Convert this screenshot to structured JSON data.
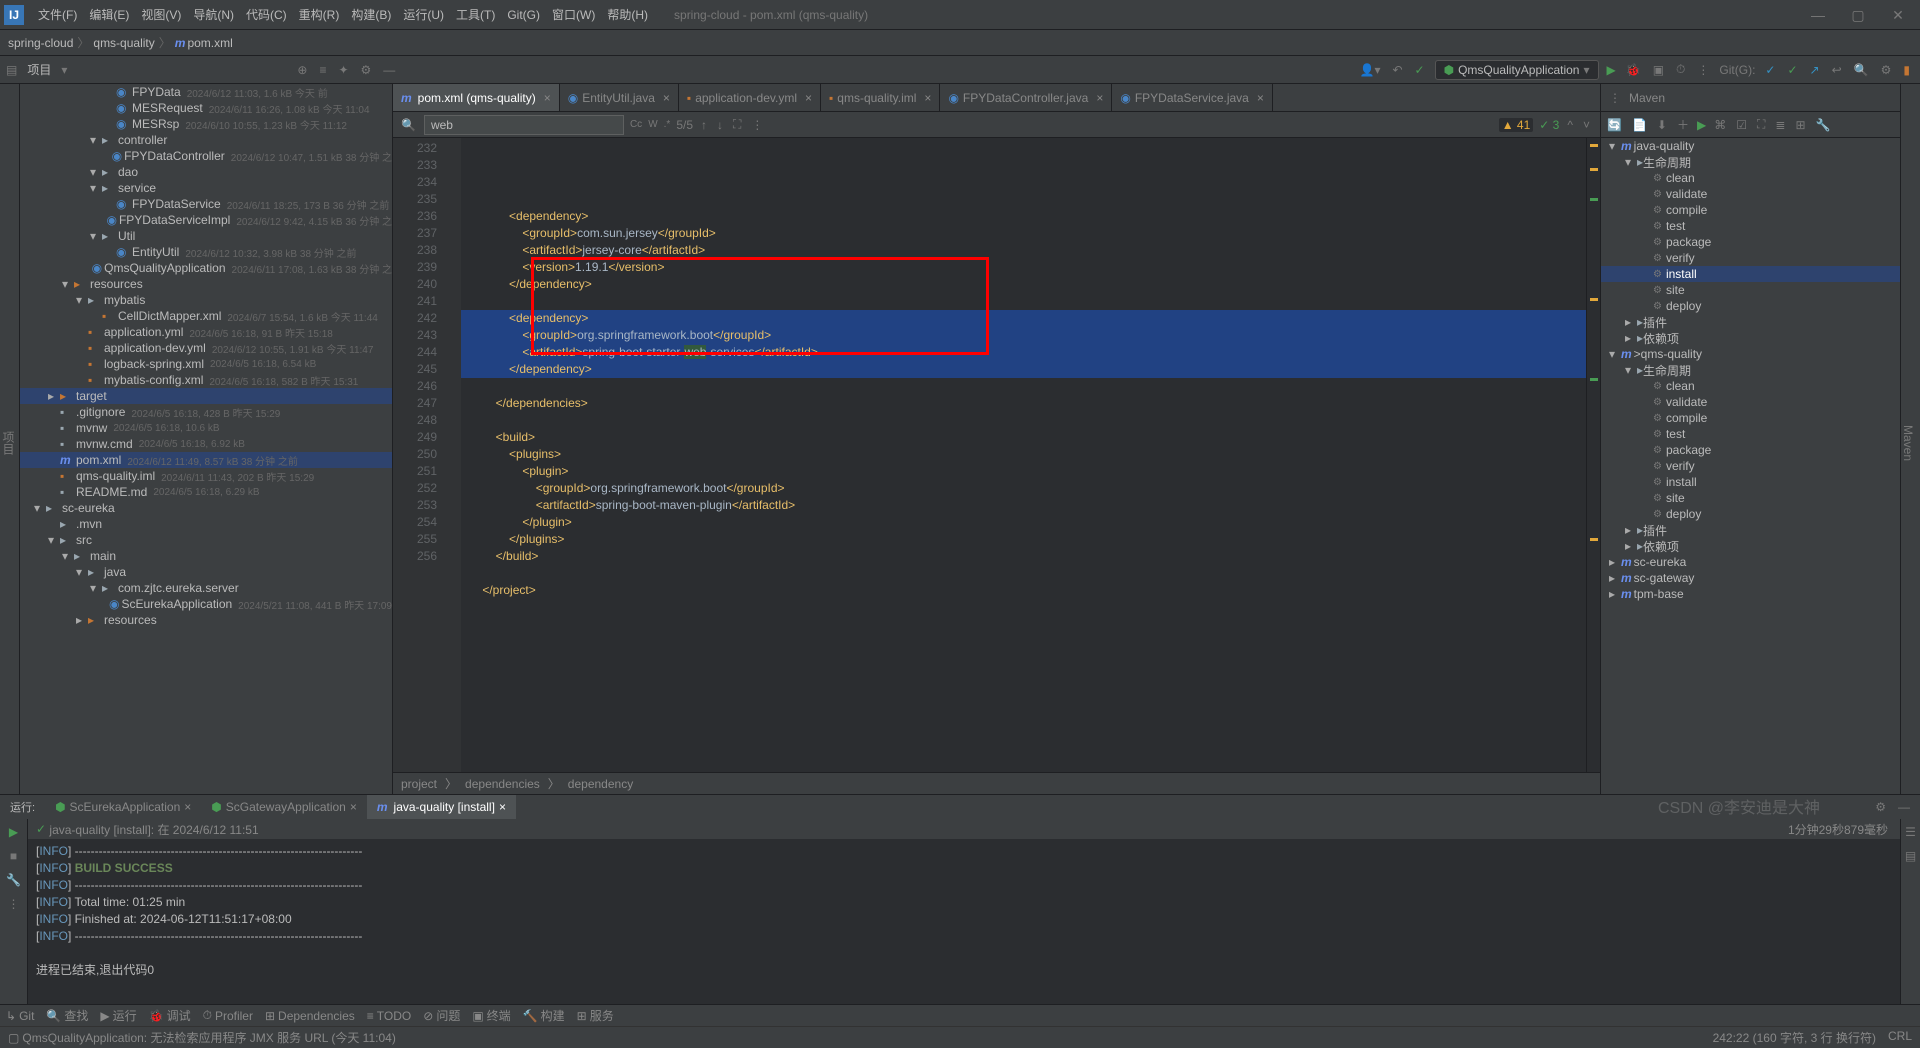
{
  "window": {
    "title": "spring-cloud - pom.xml (qms-quality)"
  },
  "menus": [
    "文件(F)",
    "编辑(E)",
    "视图(V)",
    "导航(N)",
    "代码(C)",
    "重构(R)",
    "构建(B)",
    "运行(U)",
    "工具(T)",
    "Git(G)",
    "窗口(W)",
    "帮助(H)"
  ],
  "breadcrumb": {
    "root": "spring-cloud",
    "mid": "qms-quality",
    "file": "pom.xml"
  },
  "toolbar": {
    "project_label": "项目",
    "run_config": "QmsQualityApplication",
    "git_label": "Git(G):"
  },
  "tabs": [
    {
      "label": "pom.xml (qms-quality)",
      "active": true,
      "icon": "m"
    },
    {
      "label": "EntityUtil.java",
      "icon": "j"
    },
    {
      "label": "application-dev.yml",
      "icon": "y"
    },
    {
      "label": "qms-quality.iml",
      "icon": "i"
    },
    {
      "label": "FPYDataController.java",
      "icon": "j"
    },
    {
      "label": "FPYDataService.java",
      "icon": "j"
    }
  ],
  "search": {
    "value": "web",
    "result": "5/5",
    "opts": [
      "Cc",
      "W",
      ".*"
    ]
  },
  "warnings": "41",
  "oks": "3",
  "project_tree": [
    {
      "d": 6,
      "i": "j",
      "c": "#4a86c7",
      "n": "FPYData",
      "m": "2024/6/12 11:03, 1.6 kB 今天 前"
    },
    {
      "d": 6,
      "i": "j",
      "c": "#4a86c7",
      "n": "MESRequest",
      "m": "2024/6/11 16:26, 1.08 kB 今天 11:04"
    },
    {
      "d": 6,
      "i": "j",
      "c": "#4a86c7",
      "n": "MESRsp",
      "m": "2024/6/10 10:55, 1.23 kB 今天 11:12"
    },
    {
      "d": 5,
      "a": "▾",
      "i": "📁",
      "c": "#9aa7b0",
      "n": "controller"
    },
    {
      "d": 6,
      "i": "j",
      "c": "#4a86c7",
      "n": "FPYDataController",
      "m": "2024/6/12 10:47, 1.51 kB 38 分钟 之"
    },
    {
      "d": 5,
      "a": "▾",
      "i": "📁",
      "c": "#9aa7b0",
      "n": "dao"
    },
    {
      "d": 5,
      "a": "▾",
      "i": "📁",
      "c": "#9aa7b0",
      "n": "service"
    },
    {
      "d": 6,
      "i": "j",
      "c": "#4a86c7",
      "n": "FPYDataService",
      "m": "2024/6/11 18:25, 173 B 36 分钟 之前"
    },
    {
      "d": 6,
      "i": "j",
      "c": "#4a86c7",
      "n": "FPYDataServiceImpl",
      "m": "2024/6/12 9:42, 4.15 kB 36 分钟 之"
    },
    {
      "d": 5,
      "a": "▾",
      "i": "📁",
      "c": "#9aa7b0",
      "n": "Util"
    },
    {
      "d": 6,
      "i": "j",
      "c": "#4a86c7",
      "n": "EntityUtil",
      "m": "2024/6/12 10:32, 3.98 kB 38 分钟 之前"
    },
    {
      "d": 5,
      "i": "j",
      "c": "#4a86c7",
      "n": "QmsQualityApplication",
      "m": "2024/6/11 17:08, 1.63 kB 38 分钟 之"
    },
    {
      "d": 3,
      "a": "▾",
      "i": "📁",
      "c": "#c57633",
      "n": "resources"
    },
    {
      "d": 4,
      "a": "▾",
      "i": "📁",
      "c": "#9aa7b0",
      "n": "mybatis"
    },
    {
      "d": 5,
      "i": "x",
      "c": "#c57633",
      "n": "CellDictMapper.xml",
      "m": "2024/6/7 15:54, 1.6 kB 今天 11:44"
    },
    {
      "d": 4,
      "i": "y",
      "c": "#c57633",
      "n": "application.yml",
      "m": "2024/6/5 16:18, 91 B 昨天 15:18"
    },
    {
      "d": 4,
      "i": "y",
      "c": "#c57633",
      "n": "application-dev.yml",
      "m": "2024/6/12 10:55, 1.91 kB 今天 11:47"
    },
    {
      "d": 4,
      "i": "x",
      "c": "#c57633",
      "n": "logback-spring.xml",
      "m": "2024/6/5 16:18, 6.54 kB"
    },
    {
      "d": 4,
      "i": "x",
      "c": "#c57633",
      "n": "mybatis-config.xml",
      "m": "2024/6/5 16:18, 582 B 昨天 15:31"
    },
    {
      "d": 2,
      "a": "▸",
      "i": "📁",
      "c": "#c57633",
      "n": "target",
      "sel": true
    },
    {
      "d": 2,
      "i": "f",
      "c": "#9aa7b0",
      "n": ".gitignore",
      "m": "2024/6/5 16:18, 428 B 昨天 15:29"
    },
    {
      "d": 2,
      "i": "f",
      "c": "#9aa7b0",
      "n": "mvnw",
      "m": "2024/6/5 16:18, 10.6 kB"
    },
    {
      "d": 2,
      "i": "f",
      "c": "#9aa7b0",
      "n": "mvnw.cmd",
      "m": "2024/6/5 16:18, 6.92 kB"
    },
    {
      "d": 2,
      "i": "m",
      "c": "#6a8fef",
      "n": "pom.xml",
      "m": "2024/6/12 11:49, 8.57 kB 38 分钟 之前",
      "sel2": true
    },
    {
      "d": 2,
      "i": "i",
      "c": "#c57633",
      "n": "qms-quality.iml",
      "m": "2024/6/11 11:43, 202 B 昨天 15:29"
    },
    {
      "d": 2,
      "i": "f",
      "c": "#9aa7b0",
      "n": "README.md",
      "m": "2024/6/5 16:18, 6.29 kB"
    },
    {
      "d": 1,
      "a": "▾",
      "i": "📁",
      "c": "#9aa7b0",
      "n": "sc-eureka"
    },
    {
      "d": 2,
      "i": "📁",
      "c": "#9aa7b0",
      "n": ".mvn"
    },
    {
      "d": 2,
      "a": "▾",
      "i": "📁",
      "c": "#9aa7b0",
      "n": "src"
    },
    {
      "d": 3,
      "a": "▾",
      "i": "📁",
      "c": "#9aa7b0",
      "n": "main"
    },
    {
      "d": 4,
      "a": "▾",
      "i": "📁",
      "c": "#9aa7b0",
      "n": "java"
    },
    {
      "d": 5,
      "a": "▾",
      "i": "📁",
      "c": "#9aa7b0",
      "n": "com.zjtc.eureka.server"
    },
    {
      "d": 6,
      "i": "j",
      "c": "#4a86c7",
      "n": "ScEurekaApplication",
      "m": "2024/5/21 11:08, 441 B 昨天 17:09"
    },
    {
      "d": 4,
      "a": "▸",
      "i": "📁",
      "c": "#c57633",
      "n": "resources"
    }
  ],
  "code_lines": [
    {
      "n": 232,
      "t": "",
      "raw": "                "
    },
    {
      "n": 233,
      "t": "            <span class='tag'>&lt;dependency&gt;</span>"
    },
    {
      "n": 234,
      "t": "                <span class='tag'>&lt;groupId&gt;</span>com.sun.jersey<span class='tag'>&lt;/groupId&gt;</span>"
    },
    {
      "n": 235,
      "t": "                <span class='tag'>&lt;artifactId&gt;</span>jersey-core<span class='tag'>&lt;/artifactId&gt;</span>"
    },
    {
      "n": 236,
      "t": "                <span class='tag'>&lt;version&gt;</span>1.19.1<span class='tag'>&lt;/version&gt;</span>"
    },
    {
      "n": 237,
      "t": "            <span class='tag'>&lt;/dependency&gt;</span>"
    },
    {
      "n": 238,
      "t": ""
    },
    {
      "n": 239,
      "t": "            <span class='tag'>&lt;dependency&gt;</span>",
      "sel": true
    },
    {
      "n": 240,
      "t": "                <span class='tag'>&lt;groupId&gt;</span>org.springframework.boot<span class='tag'>&lt;/groupId&gt;</span>",
      "sel": true
    },
    {
      "n": 241,
      "t": "                <span class='tag'>&lt;artifactId&gt;</span>spring-boot-starter-<span class='hl'>web</span>-services<span class='tag'>&lt;/artifactId&gt;</span>",
      "sel": true
    },
    {
      "n": 242,
      "t": "            <span class='tag'>&lt;/dependency&gt;</span>",
      "sel": true
    },
    {
      "n": 243,
      "t": ""
    },
    {
      "n": 244,
      "t": "        <span class='tag'>&lt;/dependencies&gt;</span>"
    },
    {
      "n": 245,
      "t": ""
    },
    {
      "n": 246,
      "t": "        <span class='tag'>&lt;build&gt;</span>"
    },
    {
      "n": 247,
      "t": "            <span class='tag'>&lt;plugins&gt;</span>"
    },
    {
      "n": 248,
      "t": "                <span class='tag'>&lt;plugin&gt;</span>"
    },
    {
      "n": 249,
      "t": "                    <span class='tag'>&lt;groupId&gt;</span>org.springframework.boot<span class='tag'>&lt;/groupId&gt;</span>"
    },
    {
      "n": 250,
      "t": "                    <span class='tag'>&lt;artifactId&gt;</span>spring-boot-maven-plugin<span class='tag'>&lt;/artifactId&gt;</span>"
    },
    {
      "n": 251,
      "t": "                <span class='tag'>&lt;/plugin&gt;</span>"
    },
    {
      "n": 252,
      "t": "            <span class='tag'>&lt;/plugins&gt;</span>"
    },
    {
      "n": 253,
      "t": "        <span class='tag'>&lt;/build&gt;</span>"
    },
    {
      "n": 254,
      "t": ""
    },
    {
      "n": 255,
      "t": "    <span class='tag'>&lt;/project&gt;</span>"
    },
    {
      "n": 256,
      "t": ""
    }
  ],
  "code_breadcrumb": [
    "project",
    "dependencies",
    "dependency"
  ],
  "maven": {
    "title": "Maven",
    "tree": [
      {
        "d": 0,
        "a": "▾",
        "i": "m",
        "n": "java-quality"
      },
      {
        "d": 1,
        "a": "▾",
        "i": "📁",
        "n": "生命周期"
      },
      {
        "d": 2,
        "i": "⚙",
        "n": "clean"
      },
      {
        "d": 2,
        "i": "⚙",
        "n": "validate"
      },
      {
        "d": 2,
        "i": "⚙",
        "n": "compile"
      },
      {
        "d": 2,
        "i": "⚙",
        "n": "test"
      },
      {
        "d": 2,
        "i": "⚙",
        "n": "package"
      },
      {
        "d": 2,
        "i": "⚙",
        "n": "verify"
      },
      {
        "d": 2,
        "i": "⚙",
        "n": "install",
        "sel": true
      },
      {
        "d": 2,
        "i": "⚙",
        "n": "site"
      },
      {
        "d": 2,
        "i": "⚙",
        "n": "deploy"
      },
      {
        "d": 1,
        "a": "▸",
        "i": "📁",
        "n": "插件"
      },
      {
        "d": 1,
        "a": "▸",
        "i": "📁",
        "n": "依赖项"
      },
      {
        "d": 0,
        "a": "▾",
        "i": "m",
        "n": ">qms-quality"
      },
      {
        "d": 1,
        "a": "▾",
        "i": "📁",
        "n": "生命周期"
      },
      {
        "d": 2,
        "i": "⚙",
        "n": "clean"
      },
      {
        "d": 2,
        "i": "⚙",
        "n": "validate"
      },
      {
        "d": 2,
        "i": "⚙",
        "n": "compile"
      },
      {
        "d": 2,
        "i": "⚙",
        "n": "test"
      },
      {
        "d": 2,
        "i": "⚙",
        "n": "package"
      },
      {
        "d": 2,
        "i": "⚙",
        "n": "verify"
      },
      {
        "d": 2,
        "i": "⚙",
        "n": "install"
      },
      {
        "d": 2,
        "i": "⚙",
        "n": "site"
      },
      {
        "d": 2,
        "i": "⚙",
        "n": "deploy"
      },
      {
        "d": 1,
        "a": "▸",
        "i": "📁",
        "n": "插件"
      },
      {
        "d": 1,
        "a": "▸",
        "i": "📁",
        "n": "依赖项"
      },
      {
        "d": 0,
        "a": "▸",
        "i": "m",
        "n": "sc-eureka"
      },
      {
        "d": 0,
        "a": "▸",
        "i": "m",
        "n": "sc-gateway"
      },
      {
        "d": 0,
        "a": "▸",
        "i": "m",
        "n": "tpm-base"
      }
    ]
  },
  "run_panel": {
    "label": "运行:",
    "tabs": [
      "ScEurekaApplication",
      "ScGatewayApplication",
      "java-quality [install]"
    ],
    "status": "java-quality [install]: 在 2024/6/12 11:51",
    "elapsed": "1分钟29秒879毫秒",
    "console": [
      "[<span class='info-tag'>INFO</span>] ------------------------------------------------------------------------",
      "[<span class='info-tag'>INFO</span>] <span class='success'>BUILD SUCCESS</span>",
      "[<span class='info-tag'>INFO</span>] ------------------------------------------------------------------------",
      "[<span class='info-tag'>INFO</span>] Total time:  01:25 min",
      "[<span class='info-tag'>INFO</span>] Finished at: 2024-06-12T11:51:17+08:00",
      "[<span class='info-tag'>INFO</span>] ------------------------------------------------------------------------",
      "",
      "进程已结束,退出代码0"
    ]
  },
  "footer_tools": [
    "Git",
    "查找",
    "运行",
    "调试",
    "Profiler",
    "Dependencies",
    "TODO",
    "问题",
    "终端",
    "构建",
    "服务"
  ],
  "status": {
    "msg": "QmsQualityApplication: 无法检索应用程序 JMX 服务 URL (今天 11:04)",
    "pos": "242:22 (160 字符, 3 行 换行符)",
    "enc": "CRL"
  },
  "watermark": "CSDN @李安迪是大神"
}
